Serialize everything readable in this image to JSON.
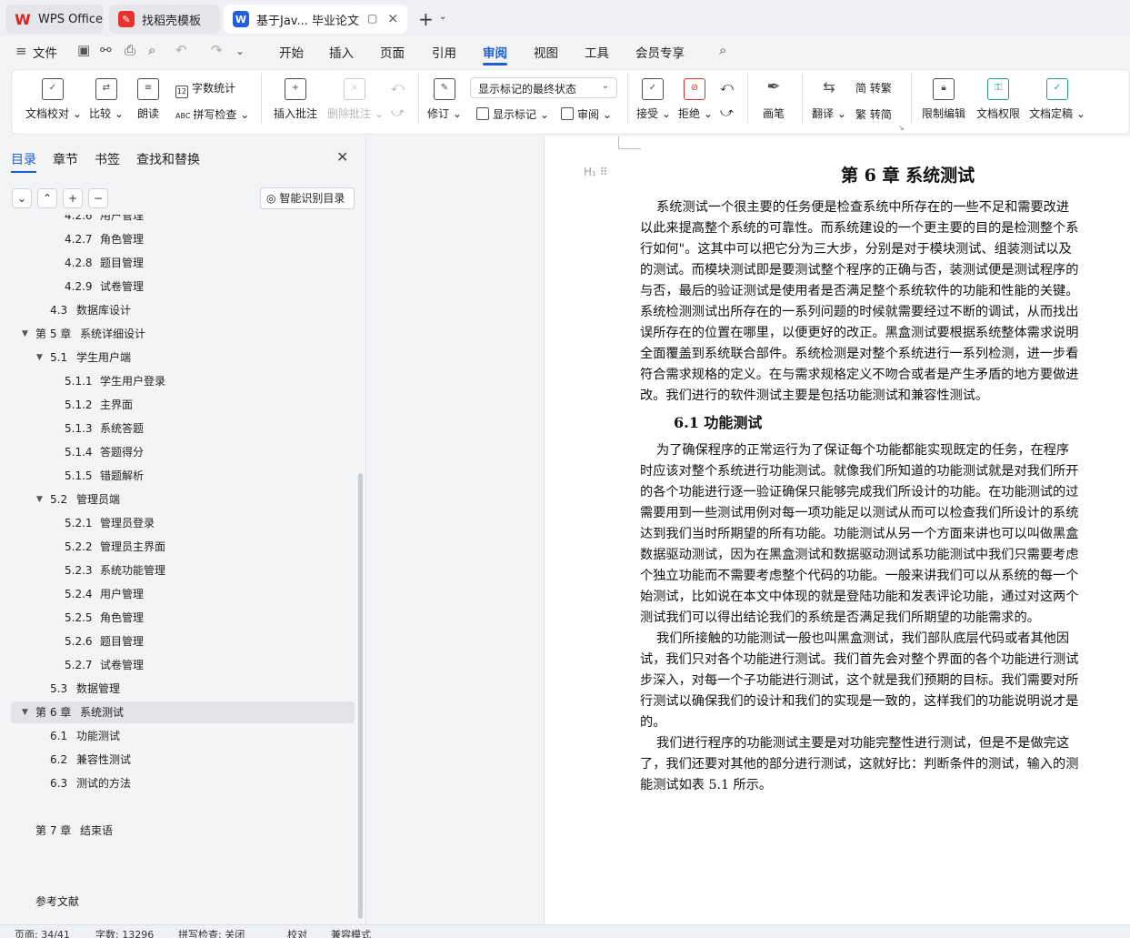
{
  "tabs": [
    {
      "label": "WPS Office"
    },
    {
      "label": "找稻壳模板"
    },
    {
      "label": "基于Jav... 毕业论文"
    }
  ],
  "menu": {
    "file": "文件",
    "items": [
      "开始",
      "插入",
      "页面",
      "引用",
      "审阅",
      "视图",
      "工具",
      "会员专享"
    ],
    "active": "审阅"
  },
  "ribbon": {
    "doc_check": "文档校对",
    "compare": "比较",
    "read_aloud": "朗读",
    "word_count": "字数统计",
    "spell_check": "拼写检查",
    "insert_comment": "插入批注",
    "delete_comment": "删除批注",
    "revise": "修订",
    "markup_state": "显示标记的最终状态",
    "show_markup": "显示标记",
    "review": "审阅",
    "accept": "接受",
    "reject": "拒绝",
    "pen": "画笔",
    "translate": "翻译",
    "to_traditional": "简 转繁",
    "to_simplified": "繁 转简",
    "restrict_edit": "限制编辑",
    "doc_permission": "文档权限",
    "doc_finalize": "文档定稿"
  },
  "panel": {
    "tabs": [
      "目录",
      "章节",
      "书签",
      "查找和替换"
    ],
    "smart_toc": "智能识别目录",
    "toc": [
      {
        "num": "4.2.6",
        "title": "用户管理",
        "level": 3
      },
      {
        "num": "4.2.7",
        "title": "角色管理",
        "level": 3
      },
      {
        "num": "4.2.8",
        "title": "题目管理",
        "level": 3
      },
      {
        "num": "4.2.9",
        "title": "试卷管理",
        "level": 3
      },
      {
        "num": "4.3",
        "title": "数据库设计",
        "level": 2
      },
      {
        "num": "第 5 章",
        "title": "系统详细设计",
        "level": 1
      },
      {
        "num": "5.1",
        "title": "学生用户端",
        "level": 2
      },
      {
        "num": "5.1.1",
        "title": "学生用户登录",
        "level": 3
      },
      {
        "num": "5.1.2",
        "title": "主界面",
        "level": 3
      },
      {
        "num": "5.1.3",
        "title": "系统答题",
        "level": 3
      },
      {
        "num": "5.1.4",
        "title": "答题得分",
        "level": 3
      },
      {
        "num": "5.1.5",
        "title": "错题解析",
        "level": 3
      },
      {
        "num": "5.2",
        "title": "管理员端",
        "level": 2
      },
      {
        "num": "5.2.1",
        "title": "管理员登录",
        "level": 3
      },
      {
        "num": "5.2.2",
        "title": "管理员主界面",
        "level": 3
      },
      {
        "num": "5.2.3",
        "title": "系统功能管理",
        "level": 3
      },
      {
        "num": "5.2.4",
        "title": "用户管理",
        "level": 3
      },
      {
        "num": "5.2.5",
        "title": "角色管理",
        "level": 3
      },
      {
        "num": "5.2.6",
        "title": "题目管理",
        "level": 3
      },
      {
        "num": "5.2.7",
        "title": "试卷管理",
        "level": 3
      },
      {
        "num": "5.3",
        "title": "数据管理",
        "level": 2
      },
      {
        "num": "第 6 章",
        "title": "系统测试",
        "level": 1
      },
      {
        "num": "6.1",
        "title": "功能测试",
        "level": 2
      },
      {
        "num": "6.2",
        "title": "兼容性测试",
        "level": 2
      },
      {
        "num": "6.3",
        "title": "测试的方法",
        "level": 2
      },
      {
        "num": "第 7 章",
        "title": "结束语",
        "level": 1
      },
      {
        "num": "参考文献",
        "title": "",
        "level": 1
      }
    ]
  },
  "document": {
    "chapter_title": "第 6 章    系统测试",
    "section_title": "6.1    功能测试",
    "para1": [
      "    系统测试一个很主要的任务便是检查系统中所存在的一些不足和需要改进",
      "以此来提高整个系统的可靠性。而系统建设的一个更主要的目的是检测整个系",
      "行如何\"。这其中可以把它分为三大步，分别是对于模块测试、组装测试以及",
      "的测试。而模块测试即是要测试整个程序的正确与否，装测试便是测试程序的",
      "与否，最后的验证测试是使用者是否满足整个系统软件的功能和性能的关键。",
      "系统检测测试出所存在的一系列问题的时候就需要经过不断的调试，从而找出",
      "误所存在的位置在哪里，以便更好的改正。黑盒测试要根据系统整体需求说明",
      "全面覆盖到系统联合部件。系统检测是对整个系统进行一系列检测，进一步看",
      "符合需求规格的定义。在与需求规格定义不吻合或者是产生矛盾的地方要做进",
      "改。我们进行的软件测试主要是包括功能测试和兼容性测试。"
    ],
    "para2": [
      "    为了确保程序的正常运行为了保证每个功能都能实现既定的任务，在程序",
      "时应该对整个系统进行功能测试。就像我们所知道的功能测试就是对我们所开",
      "的各个功能进行逐一验证确保只能够完成我们所设计的功能。在功能测试的过",
      "需要用到一些测试用例对每一项功能足以测试从而可以检查我们所设计的系统",
      "达到我们当时所期望的所有功能。功能测试从另一个方面来讲也可以叫做黑盒",
      "数据驱动测试，因为在黑盒测试和数据驱动测试系功能测试中我们只需要考虑",
      "个独立功能而不需要考虑整个代码的功能。一般来讲我们可以从系统的每一个",
      "始测试，比如说在本文中体现的就是登陆功能和发表评论功能，通过对这两个",
      "测试我们可以得出结论我们的系统是否满足我们所期望的功能需求的。",
      "    我们所接触的功能测试一般也叫黑盒测试，我们部队底层代码或者其他因",
      "试，我们只对各个功能进行测试。我们首先会对整个界面的各个功能进行测试",
      "步深入，对每一个子功能进行测试，这个就是我们预期的目标。我们需要对所",
      "行测试以确保我们的设计和我们的实现是一致的，这样我们的功能说明说才是",
      "的。",
      "    我们进行程序的功能测试主要是对功能完整性进行测试，但是不是做完这",
      "了，我们还要对其他的部分进行测试，这就好比：判断条件的测试，输入的测",
      "能测试如表 5.1 所示。"
    ]
  },
  "status": {
    "page": "页面: 34/41",
    "words": "字数: 13296",
    "spell": "拼写检查: 关闭",
    "proof": "校对",
    "compat": "兼容模式"
  }
}
